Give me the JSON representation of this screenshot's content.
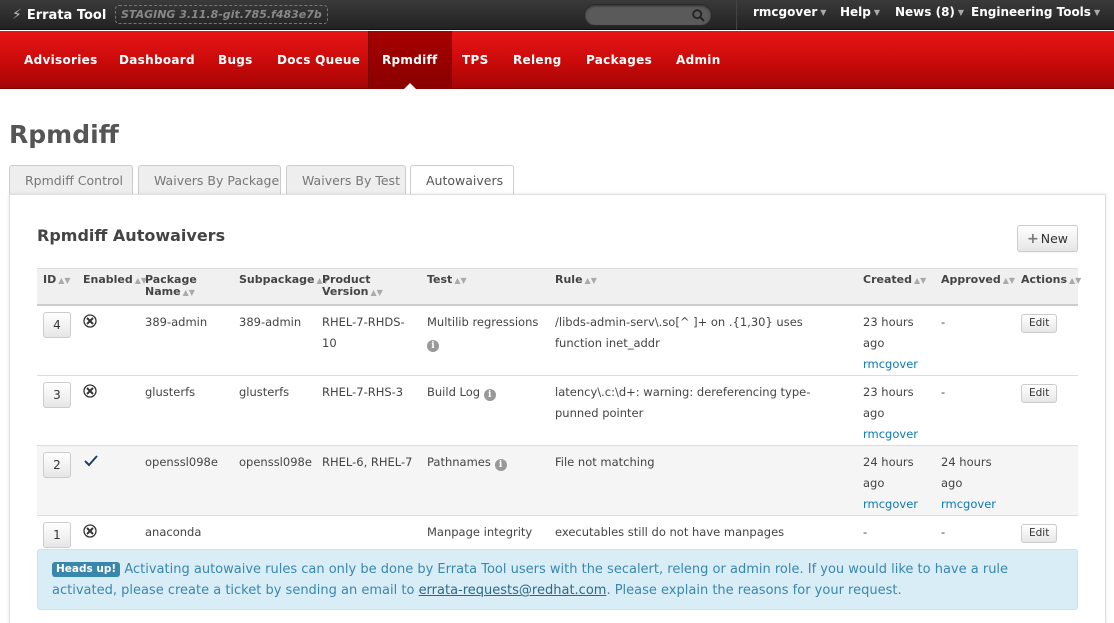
{
  "topbar": {
    "brand": "Errata Tool",
    "staging": "STAGING 3.11.8-git.785.f483e7b",
    "search_placeholder": "",
    "user": "rmcgover",
    "help": "Help",
    "news": "News (8)",
    "tools": "Engineering Tools"
  },
  "nav": [
    "Advisories",
    "Dashboard",
    "Bugs",
    "Docs Queue",
    "Rpmdiff",
    "TPS",
    "Releng",
    "Packages",
    "Admin"
  ],
  "page": {
    "title": "Rpmdiff",
    "tabs": [
      "Rpmdiff Control",
      "Waivers By Package",
      "Waivers By Test",
      "Autowaivers"
    ],
    "section_title": "Rpmdiff Autowaivers",
    "new_label": "New"
  },
  "table": {
    "headers": [
      "ID",
      "Enabled",
      "Package Name",
      "Subpackage",
      "Product Version",
      "Test",
      "Rule",
      "Created",
      "Approved",
      "Actions"
    ],
    "rows": [
      {
        "id": "4",
        "enabled": false,
        "package": "389-admin",
        "subpackage": "389-admin",
        "product": "RHEL-7-RHDS-10",
        "test": "Multilib regressions",
        "rule": "/libds-admin-serv\\.so[^ ]+ on .{1,30} uses function inet_addr",
        "created": "23 hours ago",
        "created_by": "rmcgover",
        "approved": "-",
        "approved_by": "",
        "action": "Edit"
      },
      {
        "id": "3",
        "enabled": false,
        "package": "glusterfs",
        "subpackage": "glusterfs",
        "product": "RHEL-7-RHS-3",
        "test": "Build Log",
        "rule": "latency\\.c:\\d+: warning: dereferencing type-punned pointer",
        "created": "23 hours ago",
        "created_by": "rmcgover",
        "approved": "-",
        "approved_by": "",
        "action": "Edit"
      },
      {
        "id": "2",
        "enabled": true,
        "package": "openssl098e",
        "subpackage": "openssl098e",
        "product": "RHEL-6, RHEL-7",
        "test": "Pathnames",
        "rule": "File not matching",
        "created": "24 hours ago",
        "created_by": "rmcgover",
        "approved": "24 hours ago",
        "approved_by": "rmcgover",
        "action": ""
      },
      {
        "id": "1",
        "enabled": false,
        "package": "anaconda",
        "subpackage": "",
        "product": "",
        "test": "Manpage integrity",
        "rule": "executables still do not have manpages",
        "created": "-",
        "created_by": "",
        "approved": "-",
        "approved_by": "",
        "action": "Edit"
      }
    ]
  },
  "alert": {
    "badge": "Heads up!",
    "text1": "Activating autowaive rules can only be done by Errata Tool users with the secalert, releng or admin role. If you would like to have a rule activated, please create a ticket by sending an email to ",
    "email": "errata-requests@redhat.com",
    "text2": ". Please explain the reasons for your request."
  }
}
